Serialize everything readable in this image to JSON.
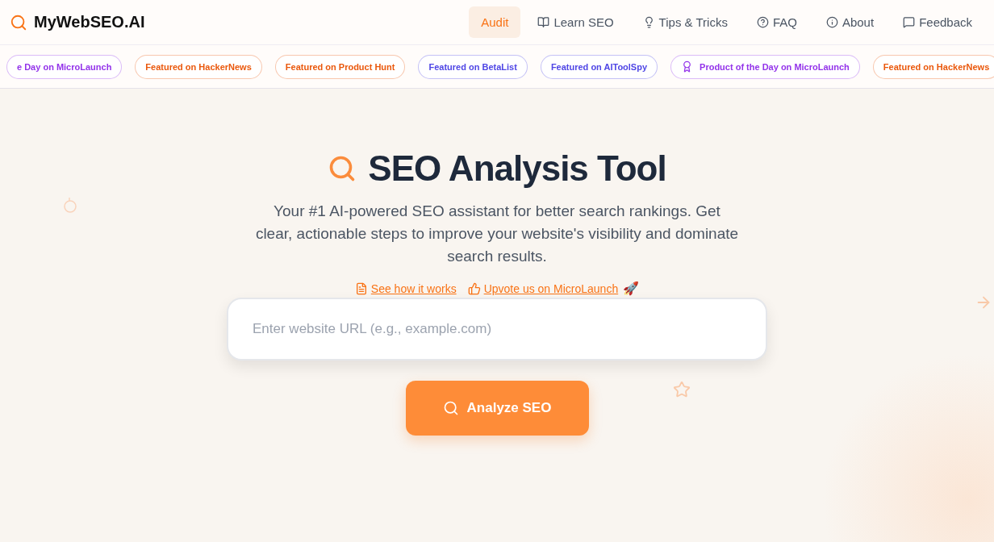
{
  "brand": {
    "name": "MyWebSEO.AI"
  },
  "nav": [
    {
      "label": "Audit",
      "selected": true,
      "kind": "plain"
    },
    {
      "label": "Learn SEO",
      "selected": false,
      "kind": "book"
    },
    {
      "label": "Tips & Tricks",
      "selected": false,
      "kind": "bulb"
    },
    {
      "label": "FAQ",
      "selected": false,
      "kind": "help"
    },
    {
      "label": "About",
      "selected": false,
      "kind": "info"
    },
    {
      "label": "Feedback",
      "selected": false,
      "kind": "message"
    }
  ],
  "badges": [
    {
      "label": "e Day on MicroLaunch",
      "color": "#9333ea",
      "kind": "plain"
    },
    {
      "label": "Featured on HackerNews",
      "color": "#ea580c",
      "kind": "plain"
    },
    {
      "label": "Featured on Product Hunt",
      "color": "#ea580c",
      "kind": "plain"
    },
    {
      "label": "Featured on BetaList",
      "color": "#4f46e5",
      "kind": "plain"
    },
    {
      "label": "Featured on AIToolSpy",
      "color": "#4f46e5",
      "kind": "plain"
    },
    {
      "label": "Product of the Day on MicroLaunch",
      "color": "#9333ea",
      "kind": "award"
    },
    {
      "label": "Featured on HackerNews",
      "color": "#ea580c",
      "kind": "plain"
    }
  ],
  "hero": {
    "title": "SEO Analysis Tool",
    "subtitle": "Your #1 AI-powered SEO assistant for better search rankings. Get clear, actionable steps to improve your website's visibility and dominate search results.",
    "links": [
      {
        "label": "See how it works",
        "kind": "document"
      },
      {
        "label": "Upvote us on MicroLaunch",
        "kind": "thumb"
      }
    ],
    "emoji": "🚀"
  },
  "search": {
    "placeholder": "Enter website URL (e.g., example.com)",
    "button": "Analyze SEO"
  }
}
